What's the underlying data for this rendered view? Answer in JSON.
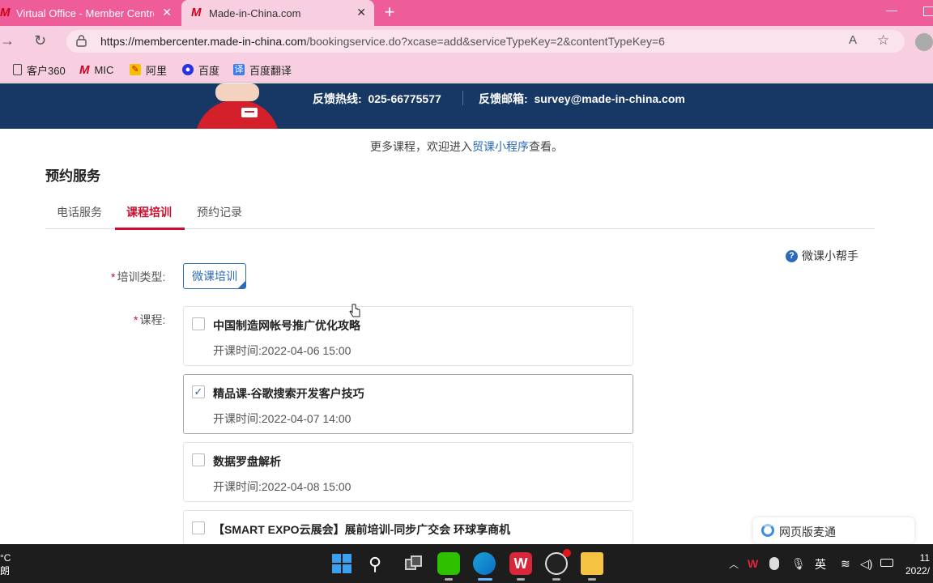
{
  "browser": {
    "tabs": [
      {
        "title": "Virtual Office - Member Centre to",
        "logo": "M",
        "active": false
      },
      {
        "title": "Made-in-China.com",
        "logo": "M",
        "active": true
      }
    ],
    "new_tab": "+",
    "url_host": "https://membercenter.made-in-china.com",
    "url_path": "/bookingservice.do?xcase=add&serviceTypeKey=2&contentTypeKey=6",
    "bookmarks": [
      {
        "label": "客户360",
        "icon": "page-icon"
      },
      {
        "label": "MIC",
        "icon": "mic-logo-icon"
      },
      {
        "label": "阿里",
        "icon": "ali-icon"
      },
      {
        "label": "百度",
        "icon": "baidu-icon"
      },
      {
        "label": "百度翻译",
        "icon": "baidu-translate-icon"
      }
    ],
    "colors": {
      "tabbar": "#ee5d99",
      "toolbar": "#f8cfe0"
    }
  },
  "header": {
    "hotline_label": "反馈热线:",
    "hotline_value": "025-66775577",
    "mail_label": "反馈邮箱:",
    "mail_value": "survey@made-in-china.com",
    "bg_color": "#173764"
  },
  "promo": {
    "prefix": "更多课程，欢迎进入",
    "link": "贸课小程序",
    "suffix": "查看。"
  },
  "page_title": "预约服务",
  "tabs": [
    {
      "label": "电话服务",
      "active": false
    },
    {
      "label": "课程培训",
      "active": true
    },
    {
      "label": "预约记录",
      "active": false
    }
  ],
  "helper_label": "微课小帮手",
  "form": {
    "type_label": "培训类型:",
    "type_value": "微课培训",
    "course_label": "课程:",
    "required_mark": "*"
  },
  "courses": [
    {
      "name": "中国制造网帐号推广优化攻略",
      "time_label": "开课时间:",
      "time": "2022-04-06 15:00",
      "checked": false
    },
    {
      "name": "精品课-谷歌搜索开发客户技巧",
      "time_label": "开课时间:",
      "time": "2022-04-07 14:00",
      "checked": true
    },
    {
      "name": "数据罗盘解析",
      "time_label": "开课时间:",
      "time": "2022-04-08 15:00",
      "checked": false
    },
    {
      "name": "【SMART EXPO云展会】展前培训-同步广交会 环球享商机",
      "time_label": "",
      "time": "",
      "checked": false
    }
  ],
  "check_glyph": "✓",
  "wechat_popup": "网页版麦通",
  "taskbar": {
    "weather_temp": "°C",
    "weather_text": "朗",
    "tray_ime": "英",
    "clock_time": "11",
    "clock_date": "2022/"
  },
  "accent_color": "#c8102e",
  "link_color": "#2a6ab8"
}
